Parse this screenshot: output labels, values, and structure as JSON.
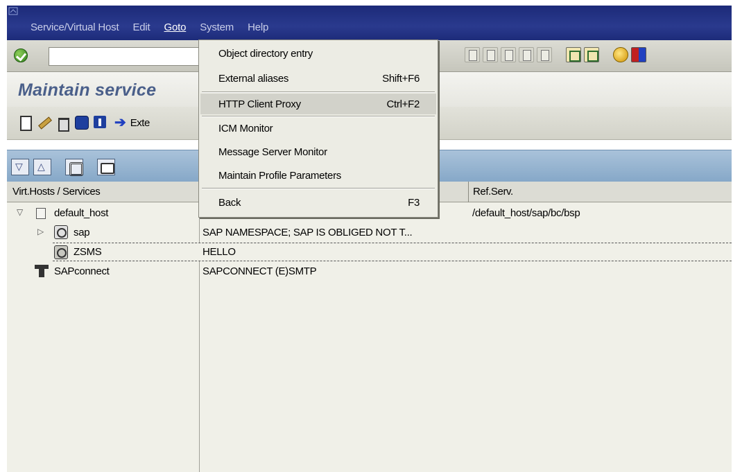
{
  "menubar": {
    "items": [
      {
        "label": "Service/Virtual Host"
      },
      {
        "label": "Edit"
      },
      {
        "label": "Goto"
      },
      {
        "label": "System"
      },
      {
        "label": "Help"
      }
    ]
  },
  "page": {
    "title": "Maintain service"
  },
  "app_toolbar": {
    "external_label": "Exte"
  },
  "columns": {
    "left": "Virt.Hosts / Services",
    "ref": "Ref.Serv."
  },
  "tree": {
    "rows": [
      {
        "name": "default_host",
        "desc": "",
        "ref": "/default_host/sap/bc/bsp"
      },
      {
        "name": "sap",
        "desc": "SAP NAMESPACE; SAP IS OBLIGED NOT T...",
        "ref": ""
      },
      {
        "name": "ZSMS",
        "desc": "HELLO",
        "ref": ""
      },
      {
        "name": "SAPconnect",
        "desc": "SAPCONNECT (E)SMTP",
        "ref": ""
      }
    ]
  },
  "goto_menu": {
    "items": [
      {
        "label": "Object directory entry",
        "shortcut": ""
      },
      {
        "label": "External aliases",
        "shortcut": "Shift+F6"
      },
      {
        "label": "HTTP Client Proxy",
        "shortcut": "Ctrl+F2"
      },
      {
        "label": "ICM Monitor",
        "shortcut": ""
      },
      {
        "label": "Message Server Monitor",
        "shortcut": ""
      },
      {
        "label": "Maintain Profile Parameters",
        "shortcut": ""
      },
      {
        "label": "Back",
        "shortcut": "F3"
      }
    ],
    "highlighted": "HTTP Client Proxy"
  }
}
